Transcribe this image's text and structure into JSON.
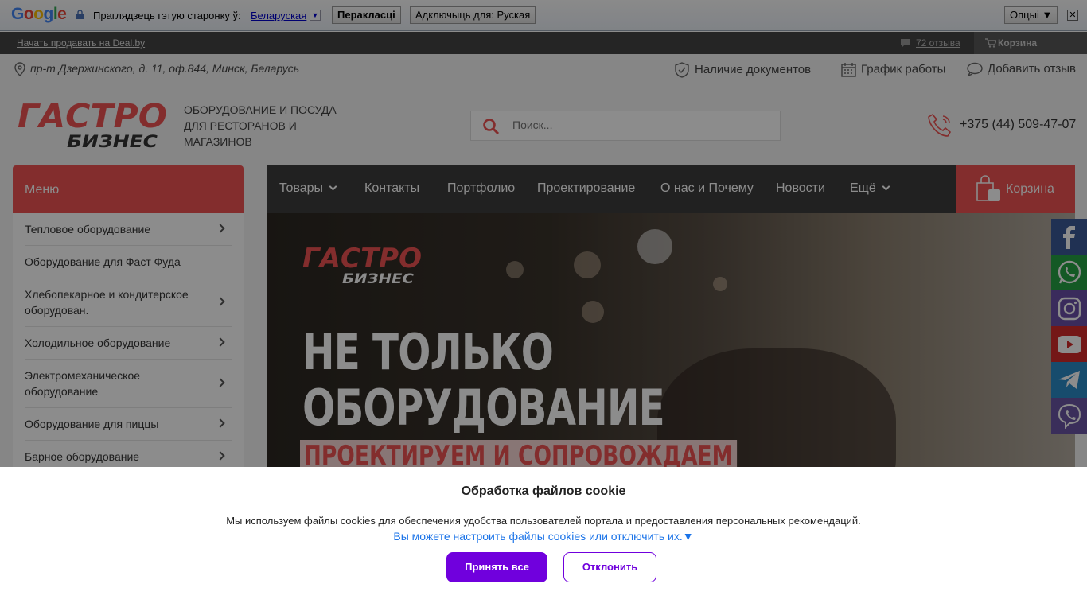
{
  "google_translate": {
    "logo_text": "Google",
    "prompt": "Праглядзець гэтую старонку ў:",
    "language": "Беларуская",
    "translate_button": "Перакласці",
    "disable_button": "Адключыць для: Руская",
    "options_button": "Опцыі ▼",
    "close": "✕"
  },
  "topbar": {
    "sell_link": "Начать продавать на Deal.by",
    "reviews": "72 отзыва",
    "cart": "Корзина"
  },
  "header": {
    "address": "пр-т Дзержинского, д. 11, оф.844, Минск, Беларусь",
    "documents": "Наличие документов",
    "schedule": "График работы",
    "add_review": "Добавить отзыв",
    "logo_top": "ГАСТРО",
    "logo_bottom": "БИЗНЕС",
    "slogan_1": "ОБОРУДОВАНИЕ И ПОСУДА",
    "slogan_2": "ДЛЯ РЕСТОРАНОВ И",
    "slogan_3": "МАГАЗИНОВ",
    "search_placeholder": "Поиск...",
    "phone": "+375 (44) 509-47-07"
  },
  "menu": {
    "title": "Меню",
    "items": [
      {
        "label": "Тепловое оборудование",
        "has_sub": true
      },
      {
        "label": "Оборудование для Фаст Фуда",
        "has_sub": false
      },
      {
        "label": "Хлебопекарное и кондитерское оборудован.",
        "has_sub": true
      },
      {
        "label": "Холодильное оборудование",
        "has_sub": true
      },
      {
        "label": "Электромеханическое оборудование",
        "has_sub": true
      },
      {
        "label": "Оборудование для пиццы",
        "has_sub": true
      },
      {
        "label": "Барное оборудование",
        "has_sub": true
      }
    ]
  },
  "nav": {
    "items": [
      "Товары",
      "Контакты",
      "Портфолио",
      "Проектирование",
      "О нас и Почему",
      "Новости",
      "Ещё"
    ],
    "cart": "Корзина"
  },
  "banner": {
    "logo_top": "ГАСТРО",
    "logo_bottom": "БИЗНЕС",
    "title_1": "НЕ ТОЛЬКО",
    "title_2": "ОБОРУДОВАНИЕ",
    "tagline": "ПРОЕКТИРУЕМ И СОПРОВОЖДАЕМ"
  },
  "social": [
    "facebook-icon",
    "whatsapp-icon",
    "instagram-icon",
    "youtube-icon",
    "telegram-icon",
    "viber-icon"
  ],
  "colors": {
    "accent": "#ee5352",
    "nav": "#3d3d3d",
    "cookie_button": "#7000dd"
  },
  "cookie": {
    "title": "Обработка файлов cookie",
    "text": "Мы используем файлы cookies для обеспечения удобства пользователей портала и предоставления персональных рекомендаций.",
    "configure": "Вы можете настроить файлы cookies или отключить их.▼",
    "accept": "Принять все",
    "reject": "Отклонить"
  }
}
